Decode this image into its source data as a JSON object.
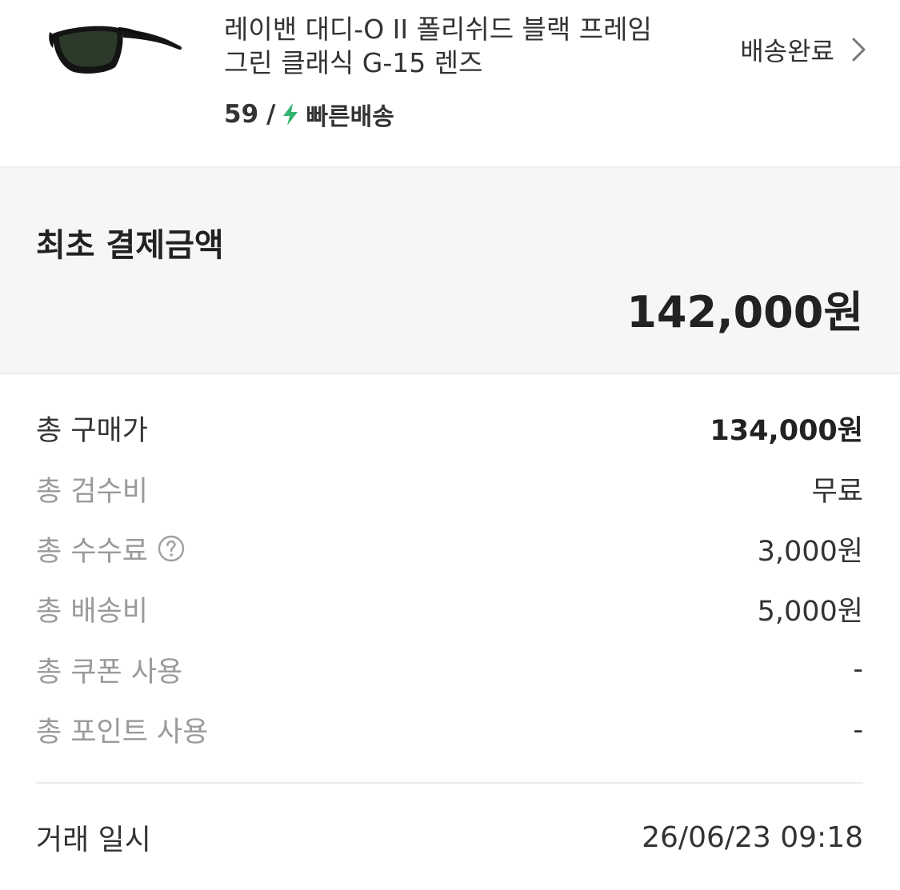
{
  "product": {
    "title_line1": "레이밴 대디-O II 폴리쉬드 블랙 프레임",
    "title_line2": "그린 클래식 G-15 렌즈",
    "size": "59",
    "separator": "/",
    "shipping_badge": "빠른배송",
    "status": "배송완료",
    "image_icon": "sunglasses-image",
    "bolt_icon": "lightning-icon",
    "bolt_color": "#31b46e"
  },
  "initial_payment": {
    "label": "최초 결제금액",
    "amount": "142,000원"
  },
  "details": [
    {
      "label": "총 구매가",
      "value": "134,000원"
    },
    {
      "label": "총 검수비",
      "value": "무료"
    },
    {
      "label": "총 수수료",
      "value": "3,000원"
    },
    {
      "label": "총 배송비",
      "value": "5,000원"
    },
    {
      "label": "총 쿠폰 사용",
      "value": "-"
    },
    {
      "label": "총 포인트 사용",
      "value": "-"
    }
  ],
  "trade": {
    "label": "거래 일시",
    "value": "26/06/23 09:18"
  }
}
